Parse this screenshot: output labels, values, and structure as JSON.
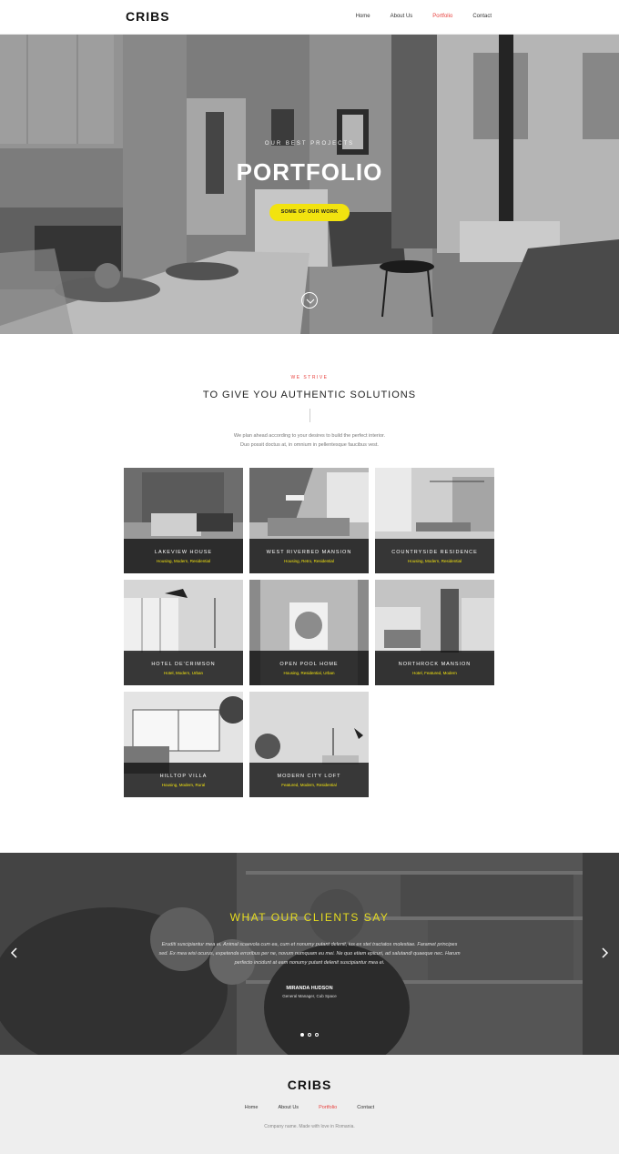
{
  "nav": {
    "logo": "CRIBS",
    "links": [
      {
        "label": "Home",
        "active": false
      },
      {
        "label": "About Us",
        "active": false
      },
      {
        "label": "Portfolio",
        "active": true
      },
      {
        "label": "Contact",
        "active": false
      }
    ]
  },
  "hero": {
    "subtitle": "OUR BEST PROJECTS",
    "title": "PORTFOLIO",
    "button_label": "SOME OF OUR WORK",
    "scroll_icon": "chevron-down-icon"
  },
  "intro": {
    "kicker": "WE STRIVE",
    "title": "TO GIVE YOU AUTHENTIC SOLUTIONS",
    "text_line1": "We plan ahead according to your desires to build the perfect interior.",
    "text_line2": "Duo possit doctus at, in omnium in pellentesque faucibus vest."
  },
  "projects": [
    {
      "title": "LAKEVIEW HOUSE",
      "tags": "Housing, Modern, Residential"
    },
    {
      "title": "WEST RIVERBED MANSION",
      "tags": "Housing, Retro, Residential"
    },
    {
      "title": "COUNTRYSIDE RESIDENCE",
      "tags": "Housing, Modern, Residential"
    },
    {
      "title": "HOTEL DE'CRIMSON",
      "tags": "Hotel, Modern, Urban"
    },
    {
      "title": "OPEN POOL HOME",
      "tags": "Housing, Residential, Urban"
    },
    {
      "title": "NORTHROCK MANSION",
      "tags": "Hotel, Featured, Modern"
    },
    {
      "title": "HILLTOP VILLA",
      "tags": "Housing, Modern, Rural"
    },
    {
      "title": "MODERN CITY LOFT",
      "tags": "Featured, Modern, Residential"
    }
  ],
  "testimonial": {
    "title": "WHAT OUR CLIENTS SAY",
    "quote_line1": "Eruditi suscipiantur mea ei. Animal scaevola cum ea, cum et nonumy putant delenit, ius ex stet tractatos molestiae. Faramet principes",
    "quote_line2": "sed. Ex mea wisi ocurus, expetenda erroribus per ne, novum numquam eu mei. Ne quo etiam epicuri, ad salutandi quaeque nec. Harum",
    "quote_line3": "perfecto incidunt at eam nonumy putant delenit suscipiantur mea ei.",
    "name": "MIRANDA HUDSON",
    "role": "General Manager, Cub Space",
    "prev_icon": "chevron-left-icon",
    "next_icon": "chevron-right-icon",
    "slides": 3,
    "active_slide": 1
  },
  "footer": {
    "logo": "CRIBS",
    "links": [
      {
        "label": "Home",
        "active": false
      },
      {
        "label": "About Us",
        "active": false
      },
      {
        "label": "Portfolio",
        "active": true
      },
      {
        "label": "Contact",
        "active": false
      }
    ],
    "copyright": "Company name. Made with love in Romania."
  },
  "colors": {
    "accent_yellow": "#f2e30f",
    "accent_red": "#e8423f"
  }
}
